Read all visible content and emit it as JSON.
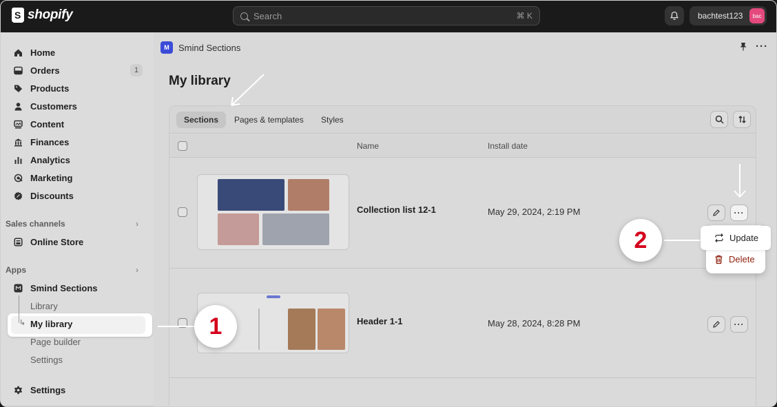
{
  "topbar": {
    "brand": "shopify",
    "search_placeholder": "Search",
    "search_shortcut": "⌘ K",
    "account_name": "bachtest123",
    "avatar_initials": "bac"
  },
  "sidebar": {
    "items": [
      {
        "label": "Home",
        "icon": "home-icon"
      },
      {
        "label": "Orders",
        "icon": "orders-icon",
        "badge": "1"
      },
      {
        "label": "Products",
        "icon": "tag-icon"
      },
      {
        "label": "Customers",
        "icon": "person-icon"
      },
      {
        "label": "Content",
        "icon": "content-icon"
      },
      {
        "label": "Finances",
        "icon": "bank-icon"
      },
      {
        "label": "Analytics",
        "icon": "bar-chart-icon"
      },
      {
        "label": "Marketing",
        "icon": "target-icon"
      },
      {
        "label": "Discounts",
        "icon": "discount-icon"
      }
    ],
    "sales_channels_label": "Sales channels",
    "online_store": "Online Store",
    "apps_label": "Apps",
    "app_name": "Smind Sections",
    "app_sub_items": [
      "Library",
      "My library",
      "Page builder",
      "Settings"
    ],
    "settings": "Settings"
  },
  "main": {
    "app_title": "Smind Sections",
    "page_title": "My library",
    "tabs": [
      "Sections",
      "Pages & templates",
      "Styles"
    ],
    "columns": {
      "name": "Name",
      "install_date": "Install date"
    },
    "rows": [
      {
        "name": "Collection list 12-1",
        "date": "May 29, 2024, 2:19 PM"
      },
      {
        "name": "Header 1-1",
        "date": "May 28, 2024, 8:28 PM"
      }
    ],
    "dropdown": {
      "update": "Update",
      "delete": "Delete"
    }
  },
  "annotations": {
    "step1": "1",
    "step2": "2"
  },
  "colors": {
    "accent_red": "#d5001c",
    "app_blue": "#3b4bd8",
    "avatar_pink": "#e4497e"
  }
}
